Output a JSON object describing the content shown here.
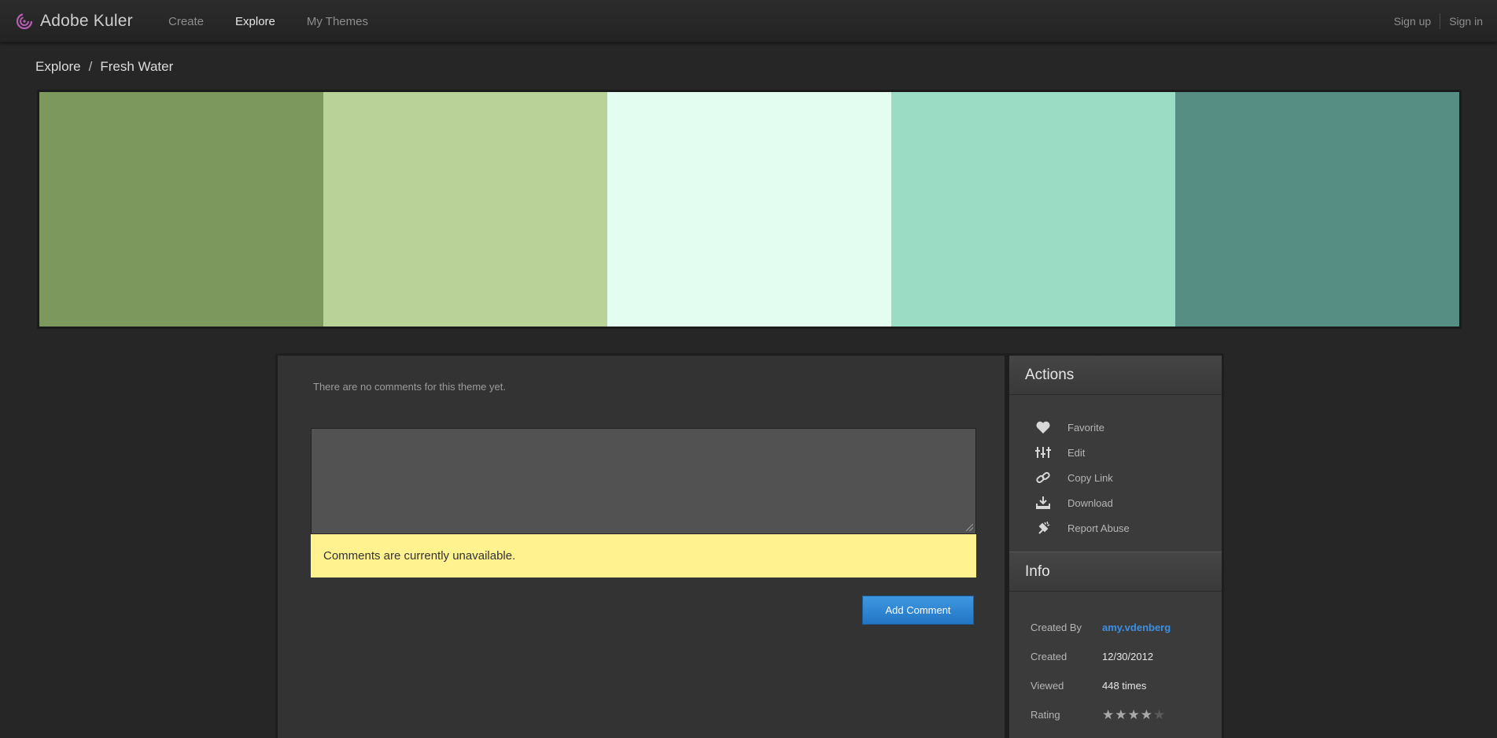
{
  "app": {
    "name": "Adobe Kuler"
  },
  "nav": [
    {
      "label": "Create",
      "active": false
    },
    {
      "label": "Explore",
      "active": true
    },
    {
      "label": "My Themes",
      "active": false
    }
  ],
  "auth": {
    "sign_up": "Sign up",
    "sign_in": "Sign in"
  },
  "breadcrumb": {
    "parent": "Explore",
    "separator": "/",
    "current": "Fresh Water"
  },
  "palette": {
    "colors": [
      "#7c985d",
      "#b9d298",
      "#e3fdf0",
      "#9bdcc5",
      "#568e84"
    ]
  },
  "comments": {
    "empty_message": "There are no comments for this theme yet.",
    "input_value": "",
    "warning": "Comments are currently unavailable.",
    "add_label": "Add Comment"
  },
  "actions": {
    "title": "Actions",
    "items": [
      {
        "label": "Favorite",
        "icon": "heart-icon"
      },
      {
        "label": "Edit",
        "icon": "sliders-icon"
      },
      {
        "label": "Copy Link",
        "icon": "link-icon"
      },
      {
        "label": "Download",
        "icon": "download-icon"
      },
      {
        "label": "Report Abuse",
        "icon": "report-icon"
      }
    ]
  },
  "info": {
    "title": "Info",
    "created_by_label": "Created By",
    "created_by": "amy.vdenberg",
    "created_label": "Created",
    "created": "12/30/2012",
    "viewed_label": "Viewed",
    "viewed": "448 times",
    "rating_label": "Rating",
    "rating": 4,
    "rating_max": 5
  },
  "colors": {
    "accent": "#3d8fe0",
    "warning_bg": "#fff28f",
    "button": "#2a80cf"
  }
}
